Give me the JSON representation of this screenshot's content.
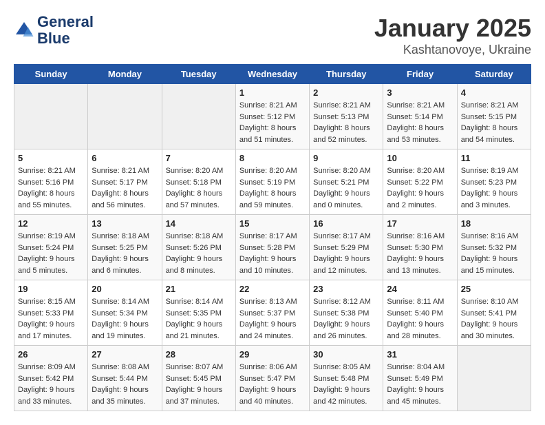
{
  "header": {
    "logo_line1": "General",
    "logo_line2": "Blue",
    "title": "January 2025",
    "subtitle": "Kashtanovoye, Ukraine"
  },
  "weekdays": [
    "Sunday",
    "Monday",
    "Tuesday",
    "Wednesday",
    "Thursday",
    "Friday",
    "Saturday"
  ],
  "weeks": [
    [
      {
        "day": "",
        "info": ""
      },
      {
        "day": "",
        "info": ""
      },
      {
        "day": "",
        "info": ""
      },
      {
        "day": "1",
        "info": "Sunrise: 8:21 AM\nSunset: 5:12 PM\nDaylight: 8 hours\nand 51 minutes."
      },
      {
        "day": "2",
        "info": "Sunrise: 8:21 AM\nSunset: 5:13 PM\nDaylight: 8 hours\nand 52 minutes."
      },
      {
        "day": "3",
        "info": "Sunrise: 8:21 AM\nSunset: 5:14 PM\nDaylight: 8 hours\nand 53 minutes."
      },
      {
        "day": "4",
        "info": "Sunrise: 8:21 AM\nSunset: 5:15 PM\nDaylight: 8 hours\nand 54 minutes."
      }
    ],
    [
      {
        "day": "5",
        "info": "Sunrise: 8:21 AM\nSunset: 5:16 PM\nDaylight: 8 hours\nand 55 minutes."
      },
      {
        "day": "6",
        "info": "Sunrise: 8:21 AM\nSunset: 5:17 PM\nDaylight: 8 hours\nand 56 minutes."
      },
      {
        "day": "7",
        "info": "Sunrise: 8:20 AM\nSunset: 5:18 PM\nDaylight: 8 hours\nand 57 minutes."
      },
      {
        "day": "8",
        "info": "Sunrise: 8:20 AM\nSunset: 5:19 PM\nDaylight: 8 hours\nand 59 minutes."
      },
      {
        "day": "9",
        "info": "Sunrise: 8:20 AM\nSunset: 5:21 PM\nDaylight: 9 hours\nand 0 minutes."
      },
      {
        "day": "10",
        "info": "Sunrise: 8:20 AM\nSunset: 5:22 PM\nDaylight: 9 hours\nand 2 minutes."
      },
      {
        "day": "11",
        "info": "Sunrise: 8:19 AM\nSunset: 5:23 PM\nDaylight: 9 hours\nand 3 minutes."
      }
    ],
    [
      {
        "day": "12",
        "info": "Sunrise: 8:19 AM\nSunset: 5:24 PM\nDaylight: 9 hours\nand 5 minutes."
      },
      {
        "day": "13",
        "info": "Sunrise: 8:18 AM\nSunset: 5:25 PM\nDaylight: 9 hours\nand 6 minutes."
      },
      {
        "day": "14",
        "info": "Sunrise: 8:18 AM\nSunset: 5:26 PM\nDaylight: 9 hours\nand 8 minutes."
      },
      {
        "day": "15",
        "info": "Sunrise: 8:17 AM\nSunset: 5:28 PM\nDaylight: 9 hours\nand 10 minutes."
      },
      {
        "day": "16",
        "info": "Sunrise: 8:17 AM\nSunset: 5:29 PM\nDaylight: 9 hours\nand 12 minutes."
      },
      {
        "day": "17",
        "info": "Sunrise: 8:16 AM\nSunset: 5:30 PM\nDaylight: 9 hours\nand 13 minutes."
      },
      {
        "day": "18",
        "info": "Sunrise: 8:16 AM\nSunset: 5:32 PM\nDaylight: 9 hours\nand 15 minutes."
      }
    ],
    [
      {
        "day": "19",
        "info": "Sunrise: 8:15 AM\nSunset: 5:33 PM\nDaylight: 9 hours\nand 17 minutes."
      },
      {
        "day": "20",
        "info": "Sunrise: 8:14 AM\nSunset: 5:34 PM\nDaylight: 9 hours\nand 19 minutes."
      },
      {
        "day": "21",
        "info": "Sunrise: 8:14 AM\nSunset: 5:35 PM\nDaylight: 9 hours\nand 21 minutes."
      },
      {
        "day": "22",
        "info": "Sunrise: 8:13 AM\nSunset: 5:37 PM\nDaylight: 9 hours\nand 24 minutes."
      },
      {
        "day": "23",
        "info": "Sunrise: 8:12 AM\nSunset: 5:38 PM\nDaylight: 9 hours\nand 26 minutes."
      },
      {
        "day": "24",
        "info": "Sunrise: 8:11 AM\nSunset: 5:40 PM\nDaylight: 9 hours\nand 28 minutes."
      },
      {
        "day": "25",
        "info": "Sunrise: 8:10 AM\nSunset: 5:41 PM\nDaylight: 9 hours\nand 30 minutes."
      }
    ],
    [
      {
        "day": "26",
        "info": "Sunrise: 8:09 AM\nSunset: 5:42 PM\nDaylight: 9 hours\nand 33 minutes."
      },
      {
        "day": "27",
        "info": "Sunrise: 8:08 AM\nSunset: 5:44 PM\nDaylight: 9 hours\nand 35 minutes."
      },
      {
        "day": "28",
        "info": "Sunrise: 8:07 AM\nSunset: 5:45 PM\nDaylight: 9 hours\nand 37 minutes."
      },
      {
        "day": "29",
        "info": "Sunrise: 8:06 AM\nSunset: 5:47 PM\nDaylight: 9 hours\nand 40 minutes."
      },
      {
        "day": "30",
        "info": "Sunrise: 8:05 AM\nSunset: 5:48 PM\nDaylight: 9 hours\nand 42 minutes."
      },
      {
        "day": "31",
        "info": "Sunrise: 8:04 AM\nSunset: 5:49 PM\nDaylight: 9 hours\nand 45 minutes."
      },
      {
        "day": "",
        "info": ""
      }
    ]
  ]
}
